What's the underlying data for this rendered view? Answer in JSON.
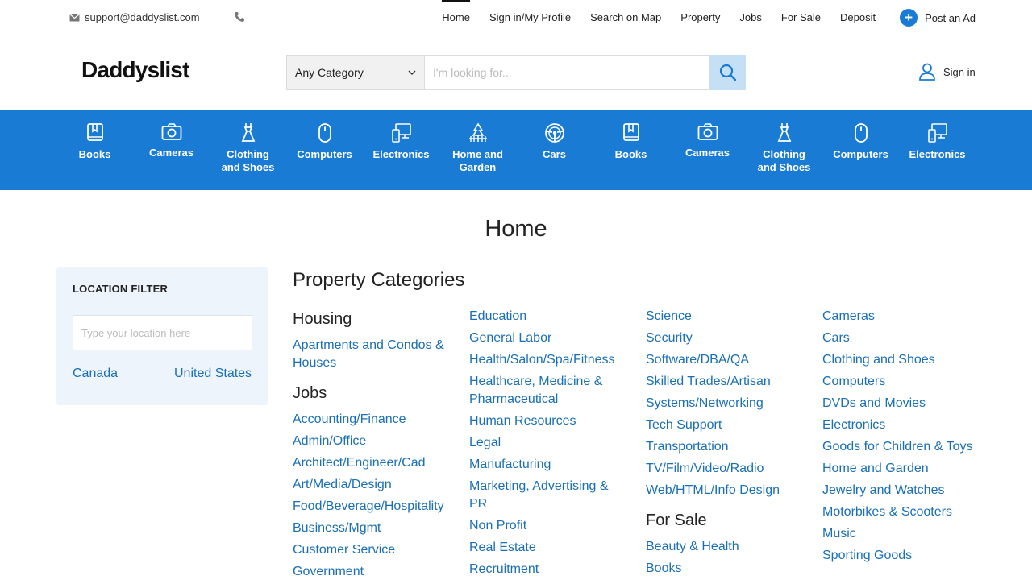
{
  "topbar": {
    "email": "support@daddyslist.com",
    "nav": [
      "Home",
      "Sign in/My Profile",
      "Search on Map",
      "Property",
      "Jobs",
      "For Sale",
      "Deposit"
    ],
    "post_ad": "Post an Ad"
  },
  "header": {
    "logo": "Daddyslist",
    "category_select": "Any Category",
    "search_placeholder": "I'm looking for...",
    "signin": "Sign in"
  },
  "categories": [
    {
      "l1": "Books",
      "l2": "",
      "icon": "book-icon"
    },
    {
      "l1": "Cameras",
      "l2": "",
      "icon": "camera-icon"
    },
    {
      "l1": "Clothing",
      "l2": "and Shoes",
      "icon": "dress-icon"
    },
    {
      "l1": "Computers",
      "l2": "",
      "icon": "mouse-icon"
    },
    {
      "l1": "Electronics",
      "l2": "",
      "icon": "devices-icon"
    },
    {
      "l1": "Home and",
      "l2": "Garden",
      "icon": "garden-icon"
    },
    {
      "l1": "Cars",
      "l2": "",
      "icon": "steering-wheel-icon"
    },
    {
      "l1": "Books",
      "l2": "",
      "icon": "book-icon"
    },
    {
      "l1": "Cameras",
      "l2": "",
      "icon": "camera-icon"
    },
    {
      "l1": "Clothing",
      "l2": "and Shoes",
      "icon": "dress-icon"
    },
    {
      "l1": "Computers",
      "l2": "",
      "icon": "mouse-icon"
    },
    {
      "l1": "Electronics",
      "l2": "",
      "icon": "devices-icon"
    }
  ],
  "page_title": "Home",
  "location_filter": {
    "title": "LOCATION FILTER",
    "placeholder": "Type your location here",
    "countries": [
      "Canada",
      "United States"
    ]
  },
  "property_categories": {
    "heading": "Property Categories",
    "columns": [
      [
        {
          "title": "Housing",
          "links": [
            "Apartments and Condos & Houses"
          ]
        },
        {
          "title": "Jobs",
          "links": [
            "Accounting/Finance",
            "Admin/Office",
            "Architect/Engineer/Cad",
            "Art/Media/Design",
            "Food/Beverage/Hospitality",
            "Business/Mgmt",
            "Customer Service",
            "Government"
          ]
        }
      ],
      [
        {
          "title": "",
          "links": [
            "Education",
            "General Labor",
            "Health/Salon/Spa/Fitness",
            "Healthcare, Medicine & Pharmaceutical",
            "Human Resources",
            "Legal",
            "Manufacturing",
            "Marketing, Advertising & PR",
            "Non Profit",
            "Real Estate",
            "Recruitment"
          ]
        }
      ],
      [
        {
          "title": "",
          "links": [
            "Science",
            "Security",
            "Software/DBA/QA",
            "Skilled Trades/Artisan",
            "Systems/Networking",
            "Tech Support",
            "Transportation",
            "TV/Film/Video/Radio",
            "Web/HTML/Info Design"
          ]
        },
        {
          "title": "For Sale",
          "links": [
            "Beauty & Health",
            "Books"
          ]
        }
      ],
      [
        {
          "title": "",
          "links": [
            "Cameras",
            "Cars",
            "Clothing and Shoes",
            "Computers",
            "DVDs and Movies",
            "Electronics",
            "Goods for Children & Toys",
            "Home and Garden",
            "Jewelry and Watches",
            "Motorbikes & Scooters",
            "Music",
            "Sporting Goods"
          ]
        }
      ]
    ]
  },
  "colors": {
    "brand_blue": "#1a7bd4",
    "link": "#1a6fb5"
  }
}
